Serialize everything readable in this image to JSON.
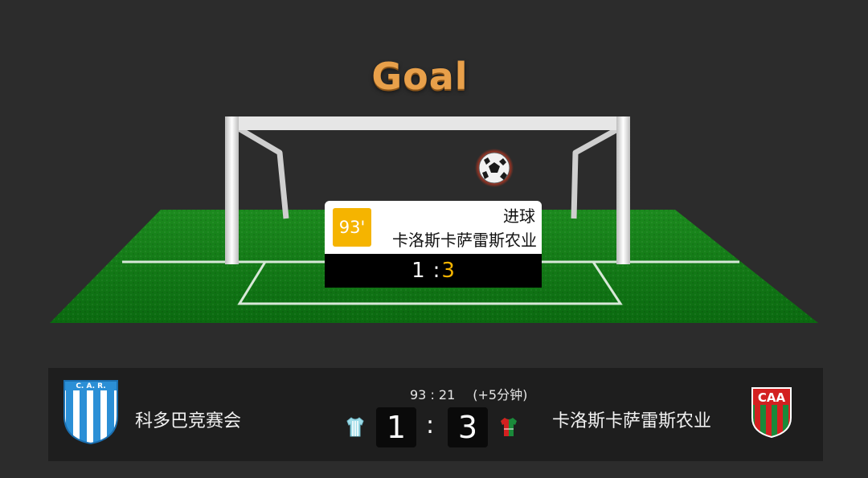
{
  "header": {
    "title": "Goal"
  },
  "event": {
    "minute": "93'",
    "type": "进球",
    "team": "卡洛斯卡萨雷斯农业",
    "score_home": "1",
    "score_sep": ":",
    "score_away": "3"
  },
  "scoreboard": {
    "time": "93 : 21",
    "added_time": "(+5分钟)",
    "home": {
      "name": "科多巴竞赛会",
      "logo_text": "C. A. R.",
      "score": "1",
      "shirt_color": "#9fdce8",
      "logo_colors": [
        "#2b8fd6",
        "#ffffff"
      ]
    },
    "away": {
      "name": "卡洛斯卡萨雷斯农业",
      "logo_text": "CAA",
      "score": "3",
      "shirt_colors": [
        "#1a8a3a",
        "#d32020"
      ],
      "logo_colors": [
        "#d32020",
        "#1a8a3a",
        "#ffffff"
      ]
    },
    "colon": ":"
  },
  "colors": {
    "background": "#2c2c2c",
    "pitch": "#0f7a14",
    "accent": "#f5b400",
    "title": "#e8a04a"
  },
  "icons": {
    "ball": "soccer-ball-icon",
    "home_shirt": "home-shirt-icon",
    "away_shirt": "away-shirt-icon"
  }
}
